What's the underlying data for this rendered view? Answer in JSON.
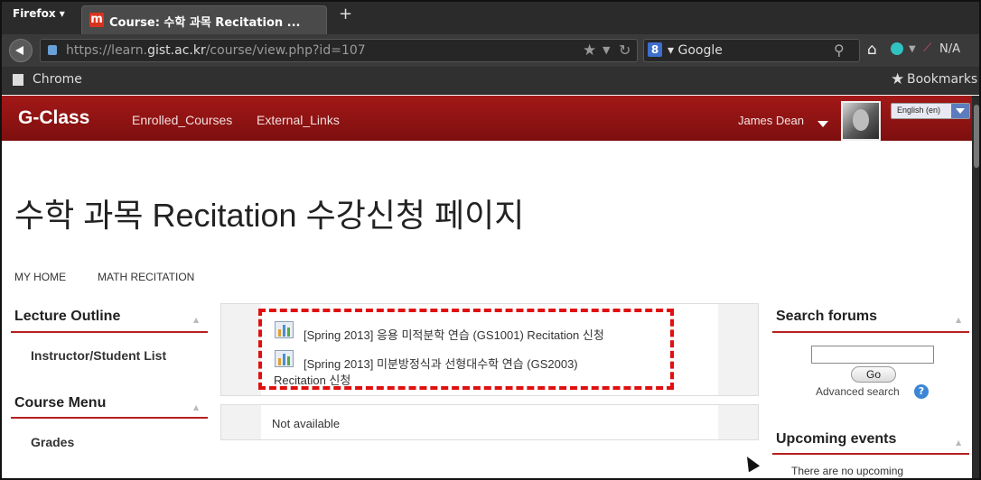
{
  "browser": {
    "menu_button": "Firefox ▾",
    "tab_title": "Course: 수학 과목 Recitation ...",
    "new_tab": "+",
    "url_scheme": "https://learn.",
    "url_host": "gist.ac.kr",
    "url_path": "/course/view.php?id=107",
    "search_engine": "▾ Google",
    "addon_label": "N/A",
    "bookmark_folder": "Chrome",
    "bookmarks_menu": "Bookmarks"
  },
  "site": {
    "brand": "G-Class",
    "nav": [
      "Enrolled_Courses",
      "External_Links"
    ],
    "user_name": "James Dean",
    "language": "English (en)",
    "accent_color": "#a31818"
  },
  "page": {
    "title": "수학 과목 Recitation 수강신청 페이지",
    "breadcrumb": [
      "MY HOME",
      "MATH RECITATION"
    ]
  },
  "left_blocks": {
    "lecture_outline": {
      "title": "Lecture Outline",
      "items": [
        "Instructor/Student List"
      ]
    },
    "course_menu": {
      "title": "Course Menu",
      "items": [
        "Grades"
      ]
    }
  },
  "main": {
    "activities": [
      {
        "line1": "[Spring 2013] 응용 미적분학 연습 (GS1001) Recitation 신청",
        "icon": "chart-icon"
      },
      {
        "line1": "[Spring 2013] 미분방정식과 선형대수학 연습 (GS2003)",
        "line2": "Recitation 신청",
        "icon": "chart-icon"
      }
    ],
    "empty_section": "Not available"
  },
  "right_blocks": {
    "search": {
      "title": "Search forums",
      "go": "Go",
      "advanced": "Advanced search",
      "help": "?"
    },
    "upcoming": {
      "title": "Upcoming events",
      "text": "There are no upcoming"
    }
  }
}
